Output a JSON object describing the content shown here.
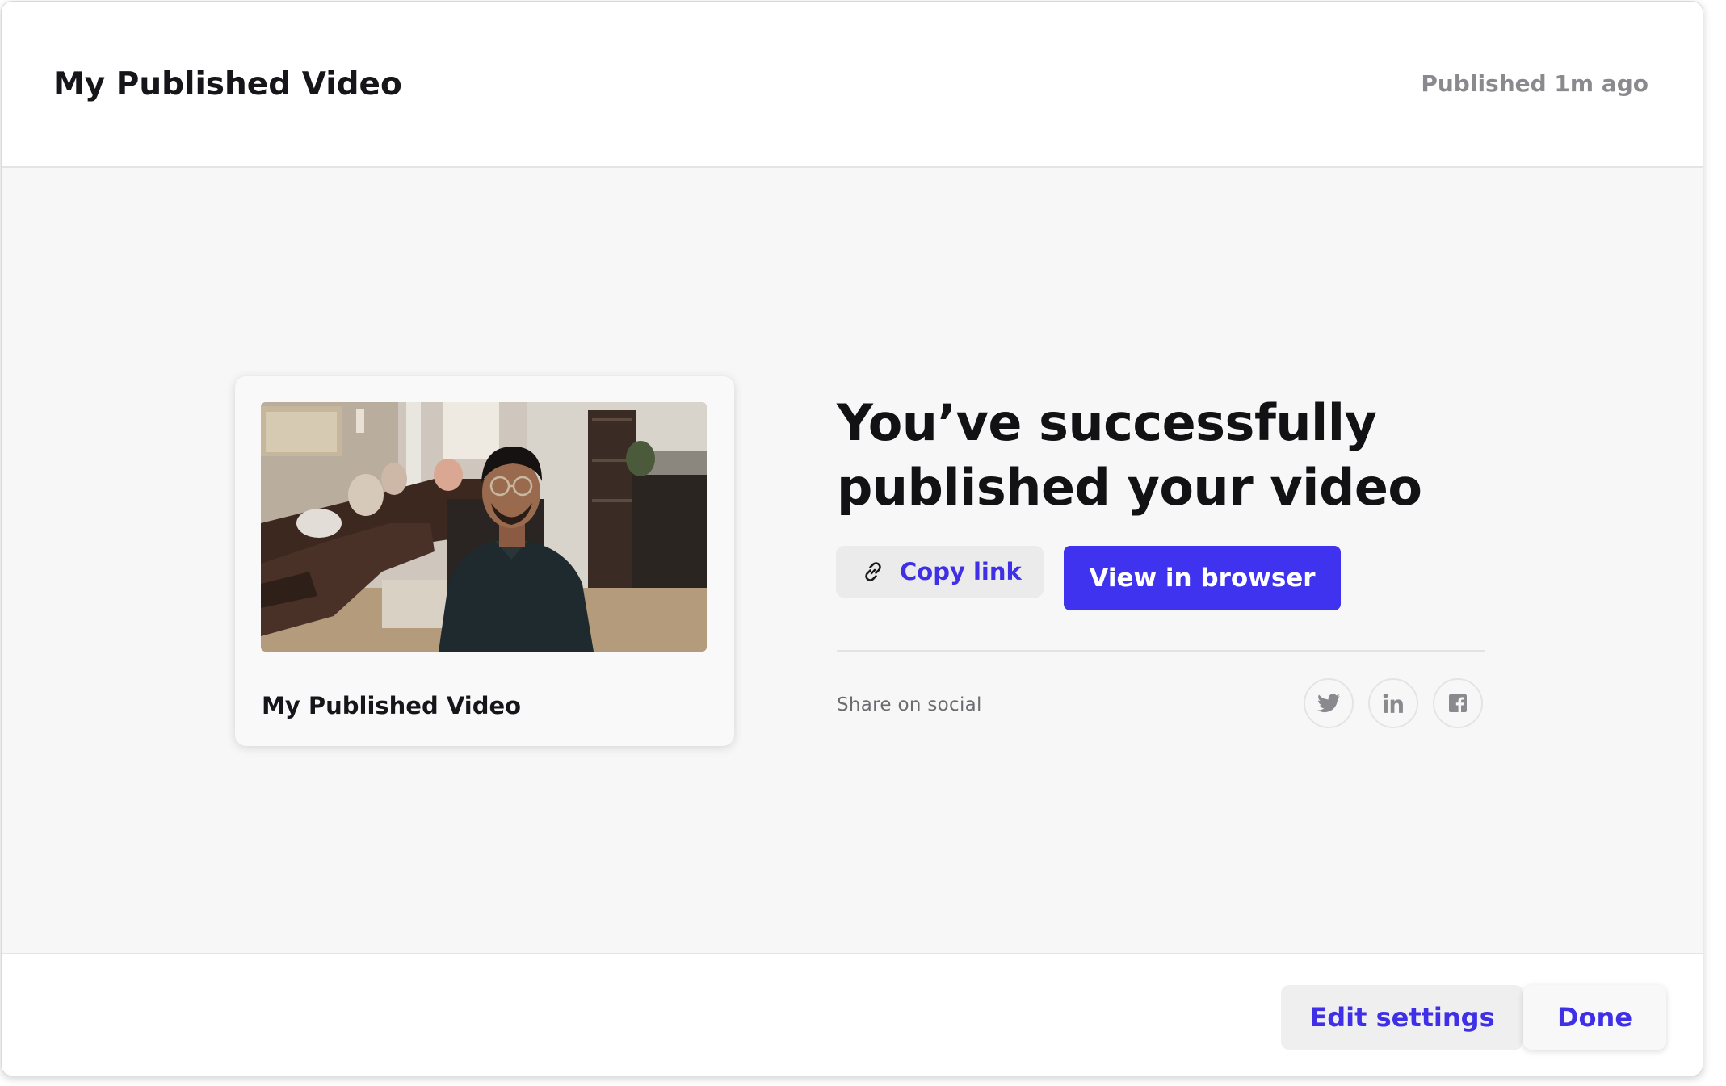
{
  "header": {
    "title": "My Published Video",
    "status": "Published 1m ago"
  },
  "video_card": {
    "title": "My Published Video",
    "thumbnail_icon": "video-thumbnail"
  },
  "main": {
    "headline": "You’ve successfully published your video",
    "copy_link_label": "Copy link",
    "copy_link_icon": "link-icon",
    "view_in_browser_label": "View in browser",
    "share_label": "Share on social",
    "social": [
      {
        "icon": "twitter-icon"
      },
      {
        "icon": "linkedin-icon"
      },
      {
        "icon": "facebook-icon"
      }
    ]
  },
  "footer": {
    "edit_settings_label": "Edit settings",
    "done_label": "Done"
  },
  "colors": {
    "accent": "#4033ef",
    "accent_text": "#3f2fe6",
    "muted_text": "#8a8a8e"
  }
}
